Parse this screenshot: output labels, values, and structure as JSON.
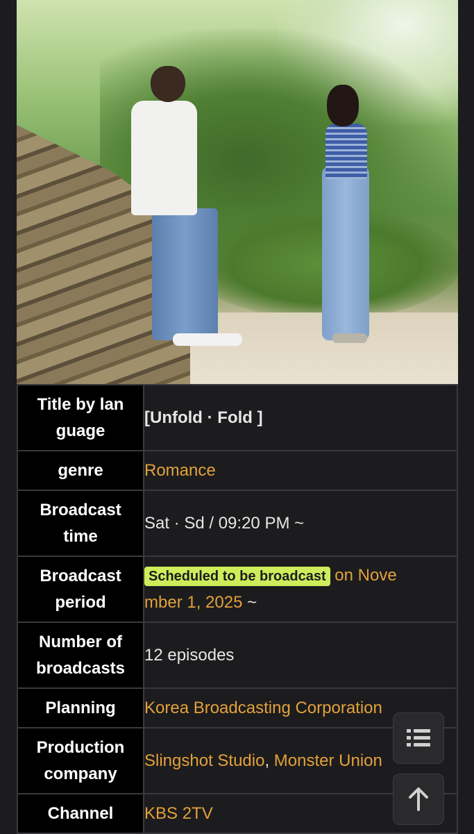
{
  "info_table": {
    "rows": [
      {
        "label": "Title by language",
        "label_lines": [
          "Title by lan",
          "guage"
        ],
        "value": "[Unfold · Fold ]"
      },
      {
        "label": "genre",
        "value": "Romance"
      },
      {
        "label": "Broadcast time",
        "label_lines": [
          "Broadcast",
          "time"
        ],
        "value": "Sat · Sd / 09:20 PM ~"
      },
      {
        "label": "Broadcast period",
        "label_lines": [
          "Broadcast",
          "period"
        ],
        "badge": "Scheduled to be broadcast",
        "value_lines": [
          "on Nove",
          "mber 1, 2025"
        ],
        "value_suffix": " ~"
      },
      {
        "label": "Number of broadcasts",
        "label_lines": [
          "Number of",
          "broadcasts"
        ],
        "value": "12 episodes"
      },
      {
        "label": "Planning",
        "value": "Korea Broadcasting Corporation"
      },
      {
        "label": "Production company",
        "label_lines": [
          "Production",
          "company"
        ],
        "values": [
          "Slingshot Studio",
          "Monster Union"
        ],
        "separator": ", "
      },
      {
        "label": "Channel",
        "value": "KBS 2TV"
      }
    ]
  },
  "floating_buttons": {
    "toc_icon": "list-icon",
    "top_icon": "arrow-up-icon"
  },
  "colors": {
    "link": "#e3a13a",
    "badge": "#cdee5a",
    "key_background": "#000000",
    "page_background": "#1c1c1e"
  }
}
